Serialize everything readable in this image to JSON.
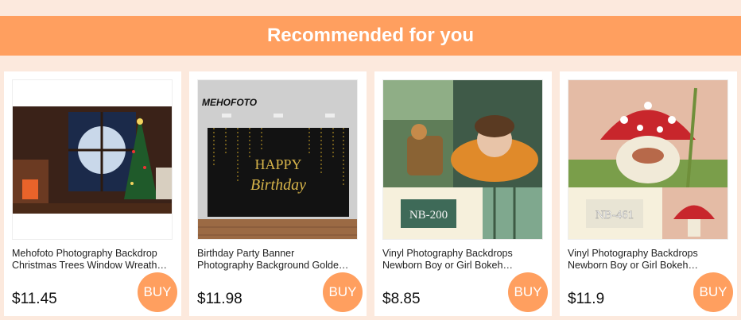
{
  "header": {
    "title": "Recommended for you"
  },
  "products": [
    {
      "title_line1": "Mehofoto Photography Backdrop",
      "title_line2": "Christmas Trees Window Wreath…",
      "price": "$11.45",
      "buy_label": "BUY"
    },
    {
      "title_line1": "Birthday Party Banner",
      "title_line2": "Photography Background Golde…",
      "price": "$11.98",
      "buy_label": "BUY",
      "image_brand": "MEHOFOTO",
      "image_text1": "HAPPY",
      "image_text2": "Birthday"
    },
    {
      "title_line1": "Vinyl Photography Backdrops",
      "title_line2": "Newborn Boy or Girl Bokeh…",
      "price": "$8.85",
      "buy_label": "BUY",
      "image_code": "NB-200"
    },
    {
      "title_line1": "Vinyl Photography Backdrops",
      "title_line2": "Newborn Boy or Girl Bokeh…",
      "price": "$11.9",
      "buy_label": "BUY",
      "image_code": "NB-461"
    }
  ],
  "colors": {
    "accent": "#ff9f5f",
    "background": "#fce9dd"
  }
}
